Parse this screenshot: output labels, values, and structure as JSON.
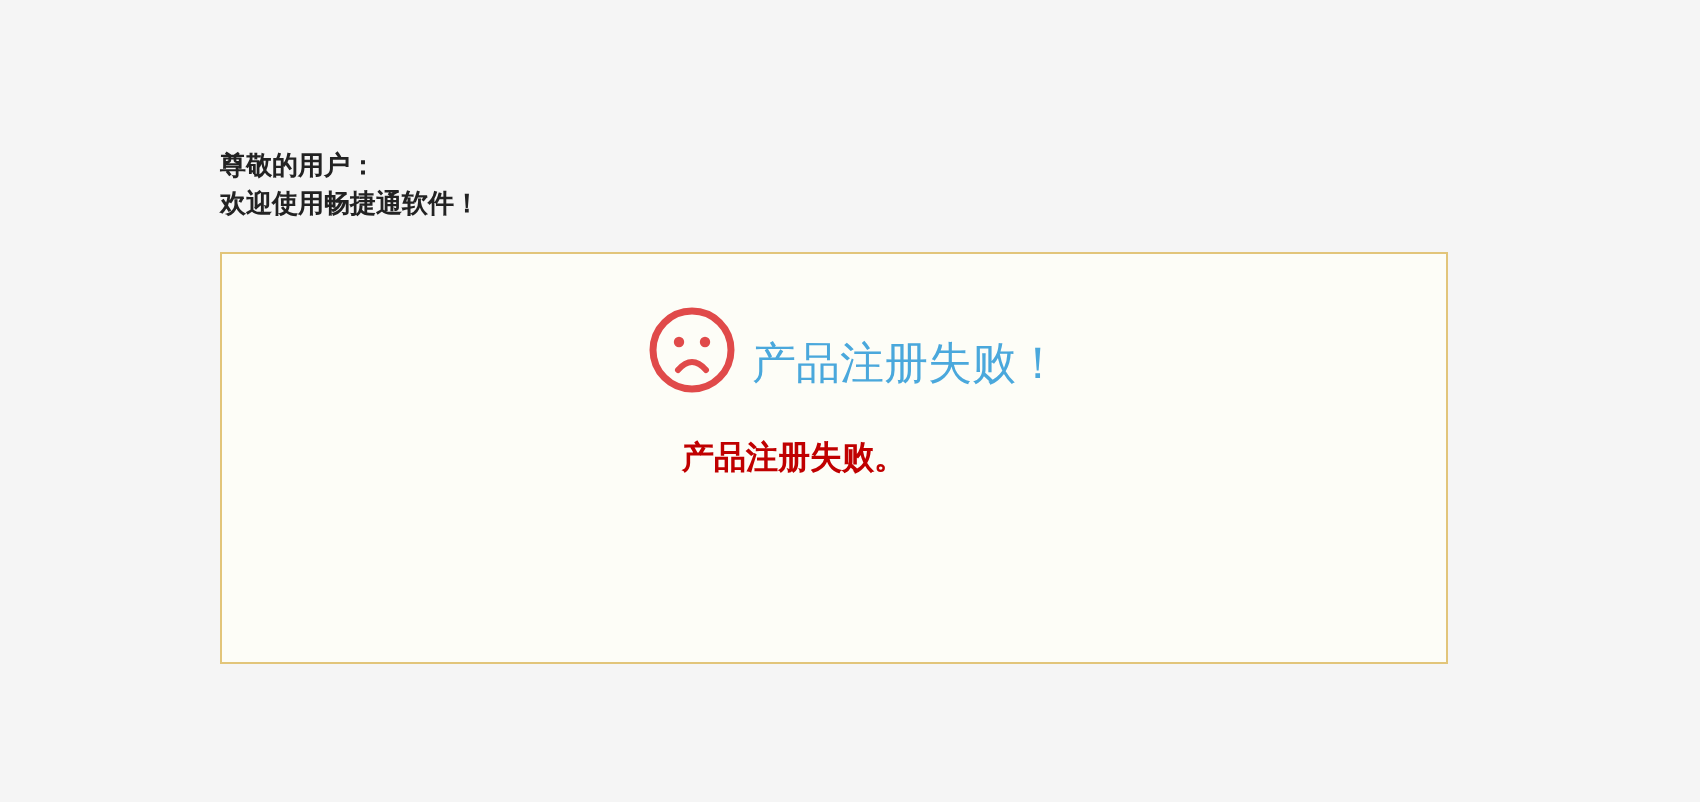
{
  "greeting": {
    "salutation": "尊敬的用户：",
    "welcome": "欢迎使用畅捷通软件！"
  },
  "result": {
    "failed": true,
    "title": "产品注册失败！",
    "message": "产品注册失败。"
  }
}
